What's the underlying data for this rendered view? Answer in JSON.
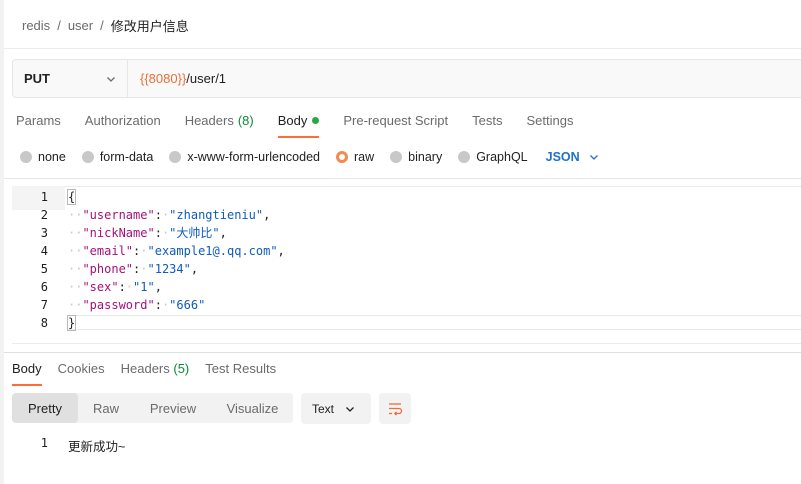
{
  "breadcrumb": {
    "items": [
      "redis",
      "user",
      "修改用户信息"
    ],
    "separator": "/"
  },
  "request": {
    "method": "PUT",
    "url_variable": "{{8080}}",
    "url_path": "/user/1"
  },
  "request_tabs": [
    {
      "label": "Params"
    },
    {
      "label": "Authorization"
    },
    {
      "label": "Headers",
      "count": "(8)"
    },
    {
      "label": "Body"
    },
    {
      "label": "Pre-request Script"
    },
    {
      "label": "Tests"
    },
    {
      "label": "Settings"
    }
  ],
  "body_types": {
    "options": [
      "none",
      "form-data",
      "x-www-form-urlencoded",
      "raw",
      "binary",
      "GraphQL"
    ],
    "selected": "raw",
    "language": "JSON"
  },
  "editor": {
    "lines": [
      {
        "n": "1",
        "text": "{"
      },
      {
        "n": "2",
        "key": "\"username\"",
        "value": "\"zhangtieniu\"",
        "end": ","
      },
      {
        "n": "3",
        "key": "\"nickName\"",
        "value": "\"大帅比\"",
        "end": ","
      },
      {
        "n": "4",
        "key": "\"email\"",
        "value": "\"example1@.qq.com\"",
        "end": ","
      },
      {
        "n": "5",
        "key": "\"phone\"",
        "value": "\"1234\"",
        "end": ","
      },
      {
        "n": "6",
        "key": "\"sex\"",
        "value": "\"1\"",
        "end": ","
      },
      {
        "n": "7",
        "key": "\"password\"",
        "value": "\"666\"",
        "end": ""
      },
      {
        "n": "8",
        "text": "}"
      }
    ]
  },
  "response_tabs": [
    {
      "label": "Body"
    },
    {
      "label": "Cookies"
    },
    {
      "label": "Headers",
      "count": "(5)"
    },
    {
      "label": "Test Results"
    }
  ],
  "response_view": {
    "modes": [
      "Pretty",
      "Raw",
      "Preview",
      "Visualize"
    ],
    "active": "Pretty",
    "format": "Text"
  },
  "response_body": {
    "line_number": "1",
    "text": "更新成功~"
  },
  "colors": {
    "accent": "#ff6c37",
    "count_green": "#0b8a37",
    "json_blue": "#1f6fd0",
    "key_color": "#a5117e",
    "string_color": "#0e5bbf"
  }
}
